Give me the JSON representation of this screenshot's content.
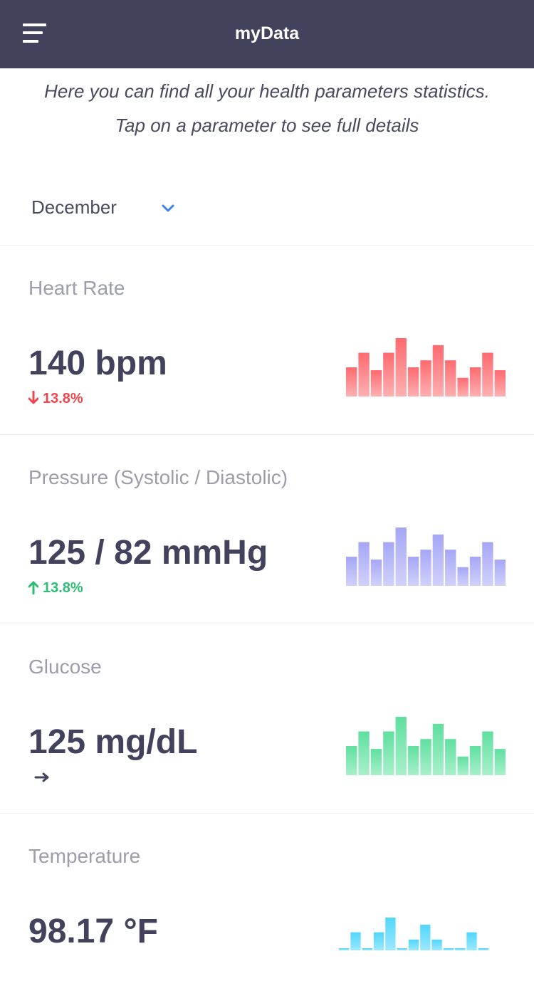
{
  "header": {
    "title": "myData",
    "menu_icon": "hamburger-menu-icon"
  },
  "intro": {
    "text": "Here you can find all your health parameters statistics. Tap on a parameter to see full details"
  },
  "month_selector": {
    "value": "December",
    "icon": "chevron-down-icon",
    "icon_color": "#3b82f6"
  },
  "parameters": [
    {
      "title": "Heart Rate",
      "value": "140 bpm",
      "change": "13.8%",
      "trend": "down",
      "trend_color": "#f0454c",
      "bar_color_top": "#ff6a6f",
      "bar_color_bottom": "#ffb0b2",
      "bars": [
        0.5,
        0.75,
        0.45,
        0.75,
        1.0,
        0.5,
        0.62,
        0.88,
        0.62,
        0.32,
        0.5,
        0.75,
        0.45
      ]
    },
    {
      "title": "Pressure (Systolic / Diastolic)",
      "value": "125 / 82 mmHg",
      "change": "13.8%",
      "trend": "up",
      "trend_color": "#2ebd75",
      "bar_color_top": "#a5a6f6",
      "bar_color_bottom": "#d1d1fb",
      "bars": [
        0.5,
        0.75,
        0.45,
        0.75,
        1.0,
        0.5,
        0.62,
        0.88,
        0.62,
        0.32,
        0.5,
        0.75,
        0.45
      ]
    },
    {
      "title": "Glucose",
      "value": "125 mg/dL",
      "change": "",
      "trend": "neutral",
      "trend_color": "#42425c",
      "bar_color_top": "#5fdf9f",
      "bar_color_bottom": "#a8f0cb",
      "bars": [
        0.5,
        0.75,
        0.45,
        0.75,
        1.0,
        0.5,
        0.62,
        0.88,
        0.62,
        0.32,
        0.5,
        0.75,
        0.45
      ]
    },
    {
      "title": "Temperature",
      "value": "98.17 °F",
      "change": "",
      "trend": "",
      "trend_color": "#42425c",
      "bar_color_top": "#4fd6fb",
      "bar_color_bottom": "#9de8ff",
      "bars": [
        0.05,
        0.55,
        0.0,
        0.55,
        1.0,
        0.05,
        0.33,
        0.78,
        0.33,
        0.0,
        0.05,
        0.55,
        0.0
      ]
    }
  ]
}
